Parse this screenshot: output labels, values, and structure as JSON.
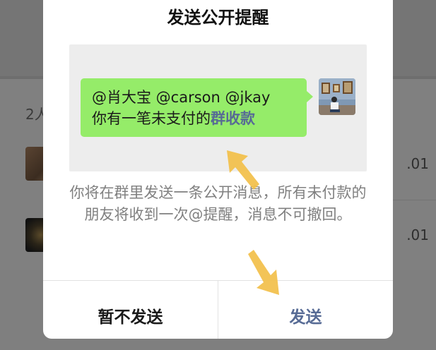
{
  "background": {
    "member_count_fragment": "2人",
    "rows": [
      {
        "amount_fragment": ".01"
      },
      {
        "amount_fragment": ".01"
      }
    ]
  },
  "dialog": {
    "title": "发送公开提醒",
    "preview": {
      "mentions": "@肖大宝 @carson @jkay",
      "message_prefix": "你有一笔未支付的",
      "link_text": "群收款",
      "bubble_color": "#95ec69",
      "link_color": "#576b95"
    },
    "description": "你将在群里发送一条公开消息，所有未付款的朋友将收到一次@提醒，消息不可撤回。",
    "buttons": {
      "cancel_label": "暂不发送",
      "send_label": "发送"
    },
    "annotation_arrow_color": "#f2c14e"
  }
}
